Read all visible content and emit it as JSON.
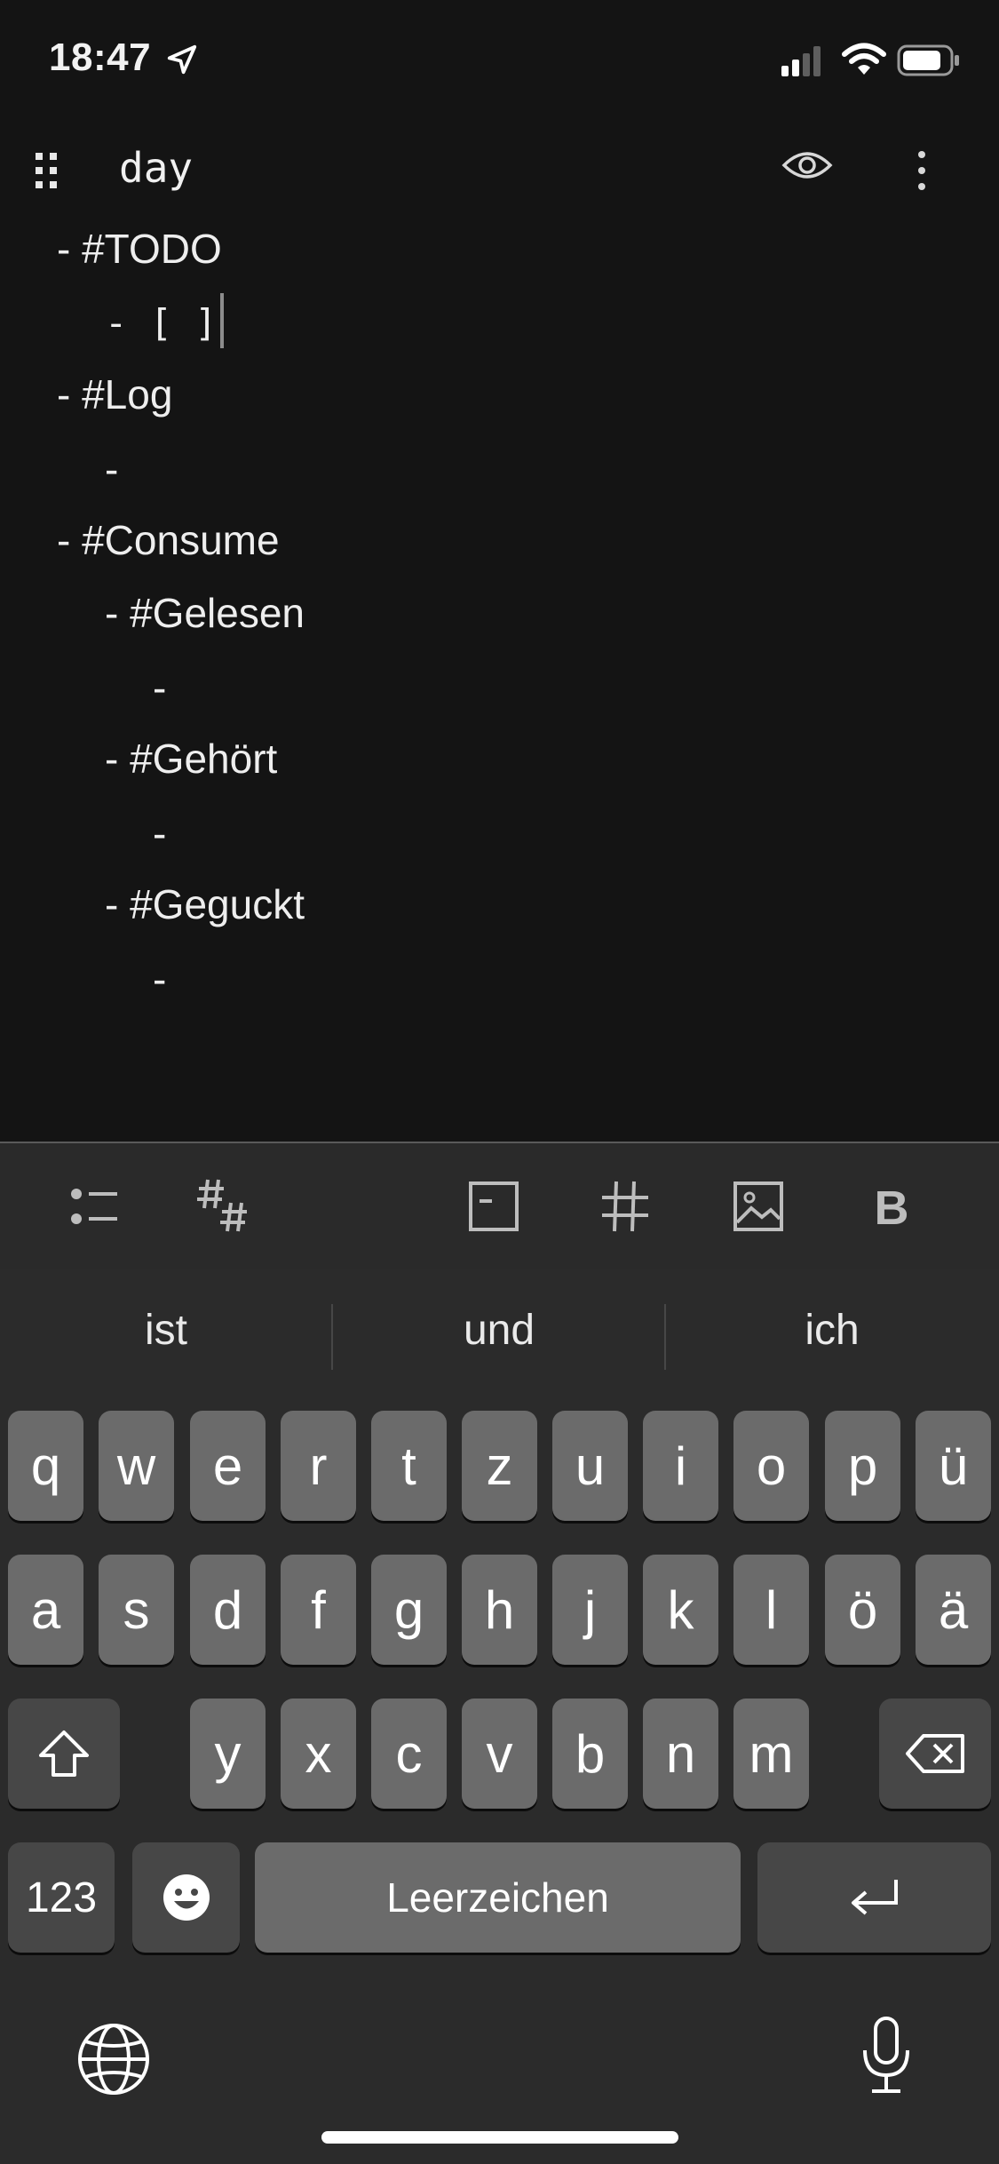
{
  "status_bar": {
    "time": "18:47"
  },
  "header": {
    "title": "day"
  },
  "editor": {
    "lines": [
      {
        "indent": 0,
        "text": "- #TODO"
      },
      {
        "indent": 1,
        "text": "- [ ]"
      },
      {
        "indent": 0,
        "text": "- #Log"
      },
      {
        "indent": 1,
        "text": "-"
      },
      {
        "indent": 0,
        "text": "- #Consume"
      },
      {
        "indent": 1,
        "text": "- #Gelesen"
      },
      {
        "indent": 2,
        "text": "-"
      },
      {
        "indent": 1,
        "text": "- #Gehört"
      },
      {
        "indent": 2,
        "text": "-"
      },
      {
        "indent": 1,
        "text": "- #Geguckt"
      },
      {
        "indent": 2,
        "text": "-"
      }
    ]
  },
  "toolbar": {
    "items": [
      "bullet-list-icon",
      "hashtags-icon",
      "heading-block-icon",
      "hash-icon",
      "image-icon",
      "bold-icon"
    ],
    "bold_label": "B"
  },
  "keyboard": {
    "suggestions": [
      "ist",
      "und",
      "ich"
    ],
    "row1": [
      "q",
      "w",
      "e",
      "r",
      "t",
      "z",
      "u",
      "i",
      "o",
      "p",
      "ü"
    ],
    "row2": [
      "a",
      "s",
      "d",
      "f",
      "g",
      "h",
      "j",
      "k",
      "l",
      "ö",
      "ä"
    ],
    "row3": [
      "y",
      "x",
      "c",
      "v",
      "b",
      "n",
      "m"
    ],
    "numbers_label": "123",
    "space_label": "Leerzeichen"
  }
}
